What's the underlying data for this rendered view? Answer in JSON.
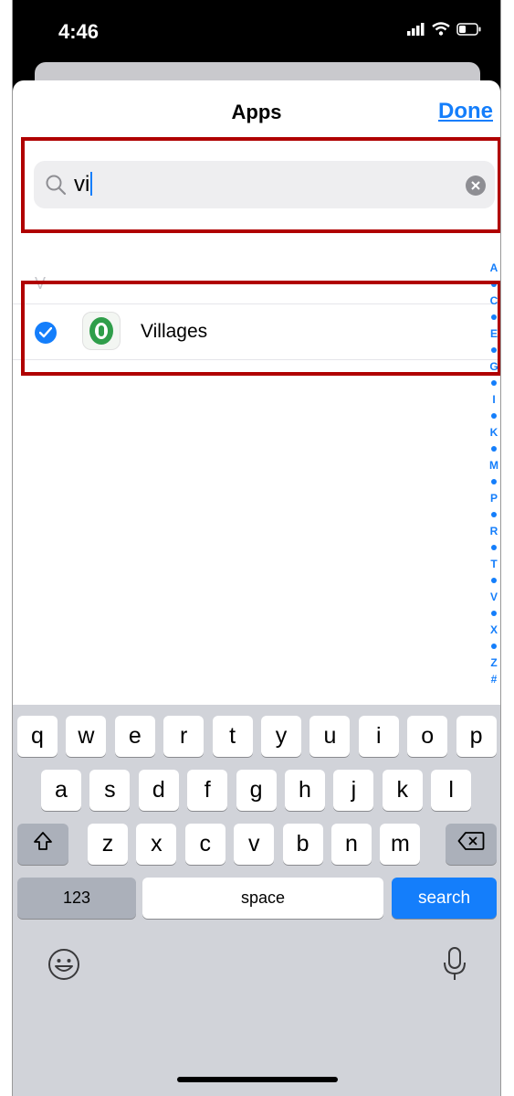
{
  "status_bar": {
    "time": "4:46",
    "icons": [
      "signal-icon",
      "wifi-icon",
      "battery-icon"
    ]
  },
  "sheet": {
    "title": "Apps",
    "done_label": "Done"
  },
  "search": {
    "query": "vi",
    "icons": [
      "magnifier-icon",
      "clear-icon"
    ]
  },
  "results": {
    "section_header": "V",
    "items": [
      {
        "name": "Villages",
        "selected": true,
        "icon": "villages-app-icon"
      }
    ]
  },
  "section_index": [
    "A",
    "C",
    "E",
    "G",
    "I",
    "K",
    "M",
    "P",
    "R",
    "T",
    "V",
    "X",
    "Z",
    "#"
  ],
  "keyboard": {
    "row1": [
      "q",
      "w",
      "e",
      "r",
      "t",
      "y",
      "u",
      "i",
      "o",
      "p"
    ],
    "row2": [
      "a",
      "s",
      "d",
      "f",
      "g",
      "h",
      "j",
      "k",
      "l"
    ],
    "row3": [
      "z",
      "x",
      "c",
      "v",
      "b",
      "n",
      "m"
    ],
    "numbers_label": "123",
    "space_label": "space",
    "search_label": "search",
    "icons": [
      "shift-icon",
      "delete-icon",
      "emoji-icon",
      "microphone-icon"
    ]
  },
  "colors": {
    "accent": "#147efb",
    "highlight": "#b00000",
    "keyboard_bg": "#d1d3d9"
  }
}
